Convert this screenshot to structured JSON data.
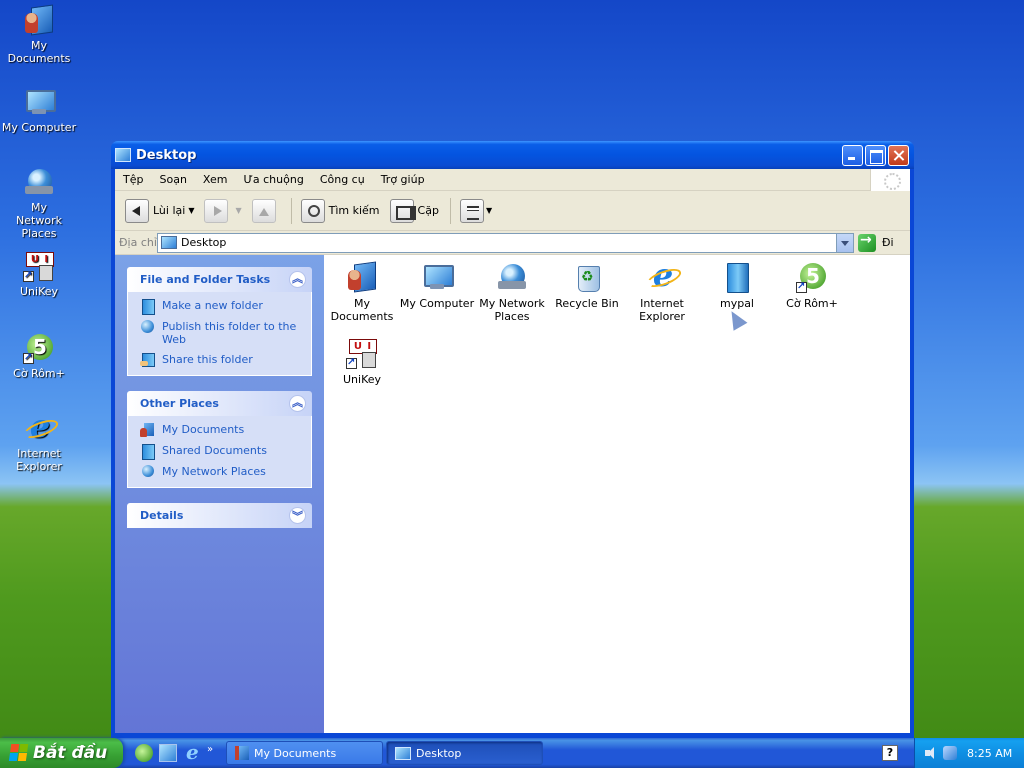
{
  "desktop": {
    "icons": [
      {
        "label": "My Documents",
        "icon": "my-documents-icon"
      },
      {
        "label": "My Computer",
        "icon": "my-computer-icon"
      },
      {
        "label": "My Network Places",
        "icon": "network-places-icon"
      },
      {
        "label": "UniKey",
        "icon": "unikey-icon"
      },
      {
        "label": "Cờ Rôm+",
        "icon": "co-rom-icon"
      },
      {
        "label": "Internet Explorer",
        "icon": "internet-explorer-icon"
      }
    ]
  },
  "window": {
    "title": "Desktop",
    "menu": [
      "Tệp",
      "Soạn",
      "Xem",
      "Ưa chuộng",
      "Công cụ",
      "Trợ giúp"
    ],
    "toolbar": {
      "back_label": "Lùi lại",
      "search_label": "Tìm kiếm",
      "folders_label": "Cặp"
    },
    "address": {
      "label": "Địa chỉ",
      "value": "Desktop",
      "go_label": "Đi"
    },
    "taskpane": {
      "file_tasks": {
        "title": "File and Folder Tasks",
        "items": [
          "Make a new folder",
          "Publish this folder to the Web",
          "Share this folder"
        ]
      },
      "other_places": {
        "title": "Other Places",
        "items": [
          "My Documents",
          "Shared Documents",
          "My Network Places"
        ]
      },
      "details": {
        "title": "Details"
      }
    },
    "files": [
      {
        "label": "My Documents",
        "icon": "my-documents-icon"
      },
      {
        "label": "My Computer",
        "icon": "my-computer-icon"
      },
      {
        "label": "My Network Places",
        "icon": "network-places-icon"
      },
      {
        "label": "Recycle Bin",
        "icon": "recycle-bin-icon"
      },
      {
        "label": "Internet Explorer",
        "icon": "internet-explorer-icon"
      },
      {
        "label": "mypal",
        "icon": "folder-icon"
      },
      {
        "label": "Cờ Rôm+",
        "icon": "co-rom-icon"
      },
      {
        "label": "UniKey",
        "icon": "unikey-icon"
      }
    ]
  },
  "taskbar": {
    "start_label": "Bắt đầu",
    "tasks": [
      {
        "label": "My Documents",
        "active": false
      },
      {
        "label": "Desktop",
        "active": true
      }
    ],
    "help_label": "?",
    "clock": "8:25 AM"
  },
  "colors": {
    "titlebar": "#0454e0",
    "taskpane_link": "#215dc6",
    "start_button": "#37a033",
    "tray": "#0f8fe3"
  }
}
